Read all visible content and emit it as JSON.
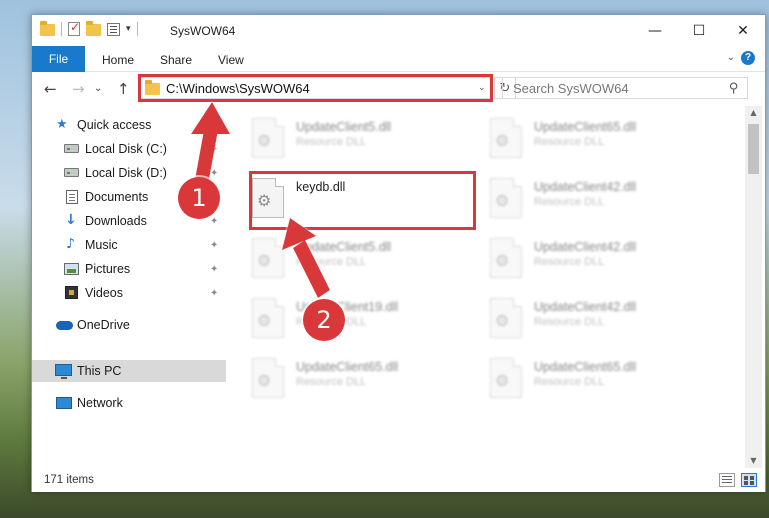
{
  "window": {
    "title": "SysWOW64",
    "controls": {
      "minimize": "—",
      "maximize": "☐",
      "close": "✕"
    }
  },
  "ribbon": {
    "file_tab": "File",
    "tabs": [
      "Home",
      "Share",
      "View"
    ],
    "help": "?",
    "expand": "⌄"
  },
  "nav": {
    "back": "←",
    "forward": "→",
    "recent": "⌄",
    "up": "↑",
    "address": "C:\\Windows\\SysWOW64",
    "address_chevron": "⌄",
    "refresh": "↻",
    "search_placeholder": "Search SysWOW64",
    "search_icon": "⚲"
  },
  "sidebar": {
    "items": [
      {
        "label": "Quick access",
        "icon": "star-icon",
        "pinned": false
      },
      {
        "label": "Local Disk (C:)",
        "icon": "disk-icon",
        "pinned": true
      },
      {
        "label": "Local Disk (D:)",
        "icon": "disk-icon",
        "pinned": true
      },
      {
        "label": "Documents",
        "icon": "document-icon",
        "pinned": true
      },
      {
        "label": "Downloads",
        "icon": "download-icon",
        "pinned": true
      },
      {
        "label": "Music",
        "icon": "music-icon",
        "pinned": true
      },
      {
        "label": "Pictures",
        "icon": "pictures-icon",
        "pinned": true
      },
      {
        "label": "Videos",
        "icon": "videos-icon",
        "pinned": true
      },
      {
        "label": "OneDrive",
        "icon": "cloud-icon",
        "pinned": false
      },
      {
        "label": "This PC",
        "icon": "computer-icon",
        "pinned": false,
        "selected": true
      },
      {
        "label": "Network",
        "icon": "network-icon",
        "pinned": false
      }
    ],
    "pin_glyph": "📌"
  },
  "files": [
    {
      "name": "UpdateClient5.dll",
      "type": "Resource DLL",
      "blurred": true
    },
    {
      "name": "UpdateClient65.dll",
      "type": "Resource DLL",
      "blurred": true
    },
    {
      "name": "keydb.dll",
      "type": "",
      "blurred": false,
      "highlighted": true
    },
    {
      "name": "UpdateClient42.dll",
      "type": "Resource DLL",
      "blurred": true
    },
    {
      "name": "UpdateClient5.dll",
      "type": "Resource DLL",
      "blurred": true
    },
    {
      "name": "UpdateClient42.dll",
      "type": "Resource DLL",
      "blurred": true
    },
    {
      "name": "UpdateClient19.dll",
      "type": "Resource DLL",
      "blurred": true
    },
    {
      "name": "UpdateClient42.dll",
      "type": "Resource DLL",
      "blurred": true
    },
    {
      "name": "UpdateClient65.dll",
      "type": "Resource DLL",
      "blurred": true
    },
    {
      "name": "UpdateClient65.dll",
      "type": "Resource DLL",
      "blurred": true
    }
  ],
  "status": {
    "item_count": "171 items"
  },
  "annotations": {
    "step1": "1",
    "step2": "2",
    "color": "#d9373a"
  }
}
